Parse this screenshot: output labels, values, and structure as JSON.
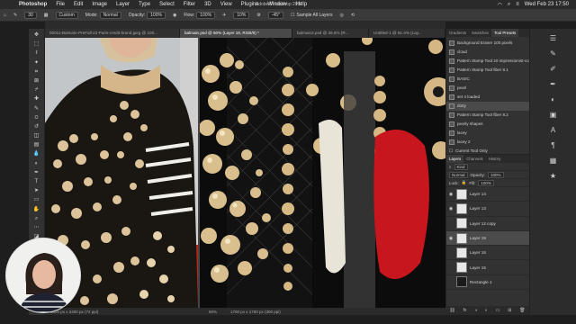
{
  "menubar": {
    "app": "Photoshop",
    "items": [
      "File",
      "Edit",
      "Image",
      "Layer",
      "Type",
      "Select",
      "Filter",
      "3D",
      "View",
      "Plugins",
      "Window",
      "Help"
    ],
    "datetime": "Wed Feb 23  17:50"
  },
  "window_title": "Adobe Photoshop 2022",
  "options": {
    "mode_label": "Mode:",
    "mode_value": "Normal",
    "opacity_label": "Opacity:",
    "opacity_value": "100%",
    "flow_label": "Flow:",
    "flow_value": "100%",
    "brush_preset": "Custom",
    "size_value": "30",
    "angle_value": "-45°",
    "smoothing_value": "10%",
    "sample_label": "Sample All Layers"
  },
  "tabs": [
    {
      "label": "00011-Balmain-PreFall-22-Paris-credit-brand.jpeg @ 100...",
      "active": false
    },
    {
      "label": "balmain.psd @ 50% (Layer 19, RGB/8) *",
      "active": true
    },
    {
      "label": "balmain2.psd @ 36.6% (R...",
      "active": false
    },
    {
      "label": "Untitled-1 @ 61.4% (Lay...",
      "active": false
    }
  ],
  "status": {
    "left": "1800 px x 2400 px (72 ppi)",
    "zoom": "50%",
    "right": "1700 px x 1700 px (300 ppi)"
  },
  "panel_tabs": [
    "Gradients",
    "Swatches",
    "Tool Presets"
  ],
  "presets": [
    "Background Eraser 100 pixels",
    "cloud",
    "Pattern Stamp Tool 20 impressionist-co",
    "Pattern Stamp Tool fiber 8.1",
    "BASIC",
    "pearl",
    "set 4 loaded",
    "dotty",
    "Pattern Stamp Tool fiber 8.2",
    "pearly shapes",
    "lacey",
    "lacey 2",
    "Current Tool Only"
  ],
  "presets_selected_index": 7,
  "layers_tabs": [
    "Layers",
    "Channels",
    "History"
  ],
  "layers_controls": {
    "kind": "Kind",
    "blend": "Normal",
    "opacity_label": "Opacity:",
    "opacity": "100%",
    "lock_label": "Lock:",
    "fill_label": "Fill:",
    "fill": "100%"
  },
  "layers": [
    {
      "name": "Layer 14",
      "visible": true,
      "dark": false
    },
    {
      "name": "Layer 13",
      "visible": true,
      "dark": false
    },
    {
      "name": "Layer 12 copy",
      "visible": false,
      "dark": false
    },
    {
      "name": "Layer 19",
      "visible": true,
      "dark": false
    },
    {
      "name": "Layer 16",
      "visible": false,
      "dark": false
    },
    {
      "name": "Layer 15",
      "visible": false,
      "dark": false
    },
    {
      "name": "Rectangle 1",
      "visible": false,
      "dark": true
    }
  ],
  "layers_selected_index": 3,
  "colors": {
    "accent": "#4a4a4a",
    "pearl": "#e3caa0",
    "red": "#c8161e"
  }
}
